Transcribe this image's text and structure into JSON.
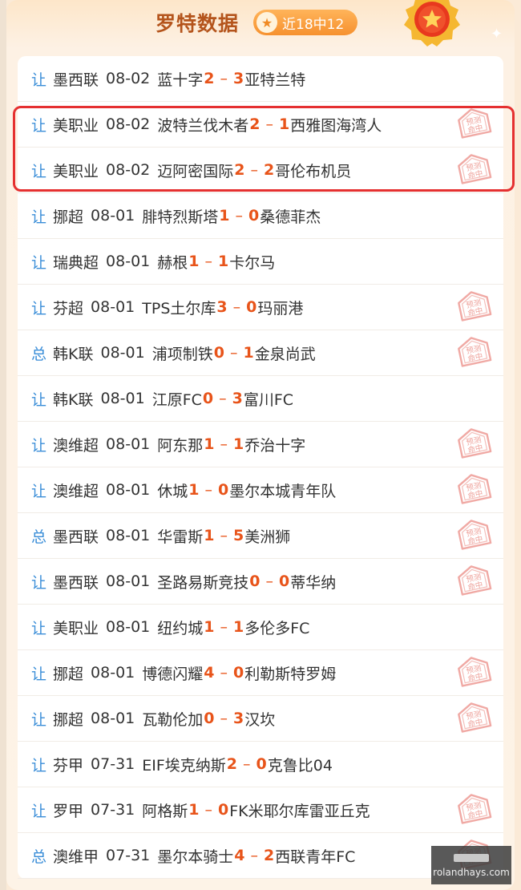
{
  "header": {
    "title": "罗特数据",
    "badge_label": "近18中12"
  },
  "colors": {
    "kind": "#3b8ed8",
    "score": "#e8541a",
    "highlight": "#e53030",
    "title": "#b4541c"
  },
  "stamp_text": "预测命中",
  "matches": [
    {
      "kind": "让",
      "league": "墨西联",
      "date": "08-02",
      "home": "蓝十字",
      "home_score": "2",
      "away_score": "3",
      "away": "亚特兰特",
      "hit": false
    },
    {
      "kind": "让",
      "league": "美职业",
      "date": "08-02",
      "home": "波特兰伐木者",
      "home_score": "2",
      "away_score": "1",
      "away": "西雅图海湾人",
      "hit": true
    },
    {
      "kind": "让",
      "league": "美职业",
      "date": "08-02",
      "home": "迈阿密国际",
      "home_score": "2",
      "away_score": "2",
      "away": "哥伦布机员",
      "hit": true
    },
    {
      "kind": "让",
      "league": "挪超",
      "date": "08-01",
      "home": "腓特烈斯塔",
      "home_score": "1",
      "away_score": "0",
      "away": "桑德菲杰",
      "hit": false
    },
    {
      "kind": "让",
      "league": "瑞典超",
      "date": "08-01",
      "home": "赫根",
      "home_score": "1",
      "away_score": "1",
      "away": "卡尔马",
      "hit": false
    },
    {
      "kind": "让",
      "league": "芬超",
      "date": "08-01",
      "home": "TPS土尔库",
      "home_score": "3",
      "away_score": "0",
      "away": "玛丽港",
      "hit": true
    },
    {
      "kind": "总",
      "league": "韩K联",
      "date": "08-01",
      "home": "浦项制铁",
      "home_score": "0",
      "away_score": "1",
      "away": "金泉尚武",
      "hit": true
    },
    {
      "kind": "让",
      "league": "韩K联",
      "date": "08-01",
      "home": "江原FC",
      "home_score": "0",
      "away_score": "3",
      "away": "富川FC",
      "hit": false
    },
    {
      "kind": "让",
      "league": "澳维超",
      "date": "08-01",
      "home": "阿东那",
      "home_score": "1",
      "away_score": "1",
      "away": "乔治十字",
      "hit": true
    },
    {
      "kind": "让",
      "league": "澳维超",
      "date": "08-01",
      "home": "休城",
      "home_score": "1",
      "away_score": "0",
      "away": "墨尔本城青年队",
      "hit": true
    },
    {
      "kind": "总",
      "league": "墨西联",
      "date": "08-01",
      "home": "华雷斯",
      "home_score": "1",
      "away_score": "5",
      "away": "美洲狮",
      "hit": true
    },
    {
      "kind": "让",
      "league": "墨西联",
      "date": "08-01",
      "home": "圣路易斯竞技",
      "home_score": "0",
      "away_score": "0",
      "away": "蒂华纳",
      "hit": true
    },
    {
      "kind": "让",
      "league": "美职业",
      "date": "08-01",
      "home": "纽约城",
      "home_score": "1",
      "away_score": "1",
      "away": "多伦多FC",
      "hit": false
    },
    {
      "kind": "让",
      "league": "挪超",
      "date": "08-01",
      "home": "博德闪耀",
      "home_score": "4",
      "away_score": "0",
      "away": "利勒斯特罗姆",
      "hit": true
    },
    {
      "kind": "让",
      "league": "挪超",
      "date": "08-01",
      "home": "瓦勒伦加",
      "home_score": "0",
      "away_score": "3",
      "away": "汉坎",
      "hit": true
    },
    {
      "kind": "让",
      "league": "芬甲",
      "date": "07-31",
      "home": "EIF埃克纳斯",
      "home_score": "2",
      "away_score": "0",
      "away": "克鲁比04",
      "hit": false
    },
    {
      "kind": "让",
      "league": "罗甲",
      "date": "07-31",
      "home": "阿格斯",
      "home_score": "1",
      "away_score": "0",
      "away": "FK米耶尔库雷亚丘克",
      "hit": true
    },
    {
      "kind": "总",
      "league": "澳维甲",
      "date": "07-31",
      "home": "墨尔本骑士",
      "home_score": "4",
      "away_score": "2",
      "away": "西联青年FC",
      "hit": true
    }
  ],
  "watermark": {
    "text": "rolandhays.com"
  }
}
